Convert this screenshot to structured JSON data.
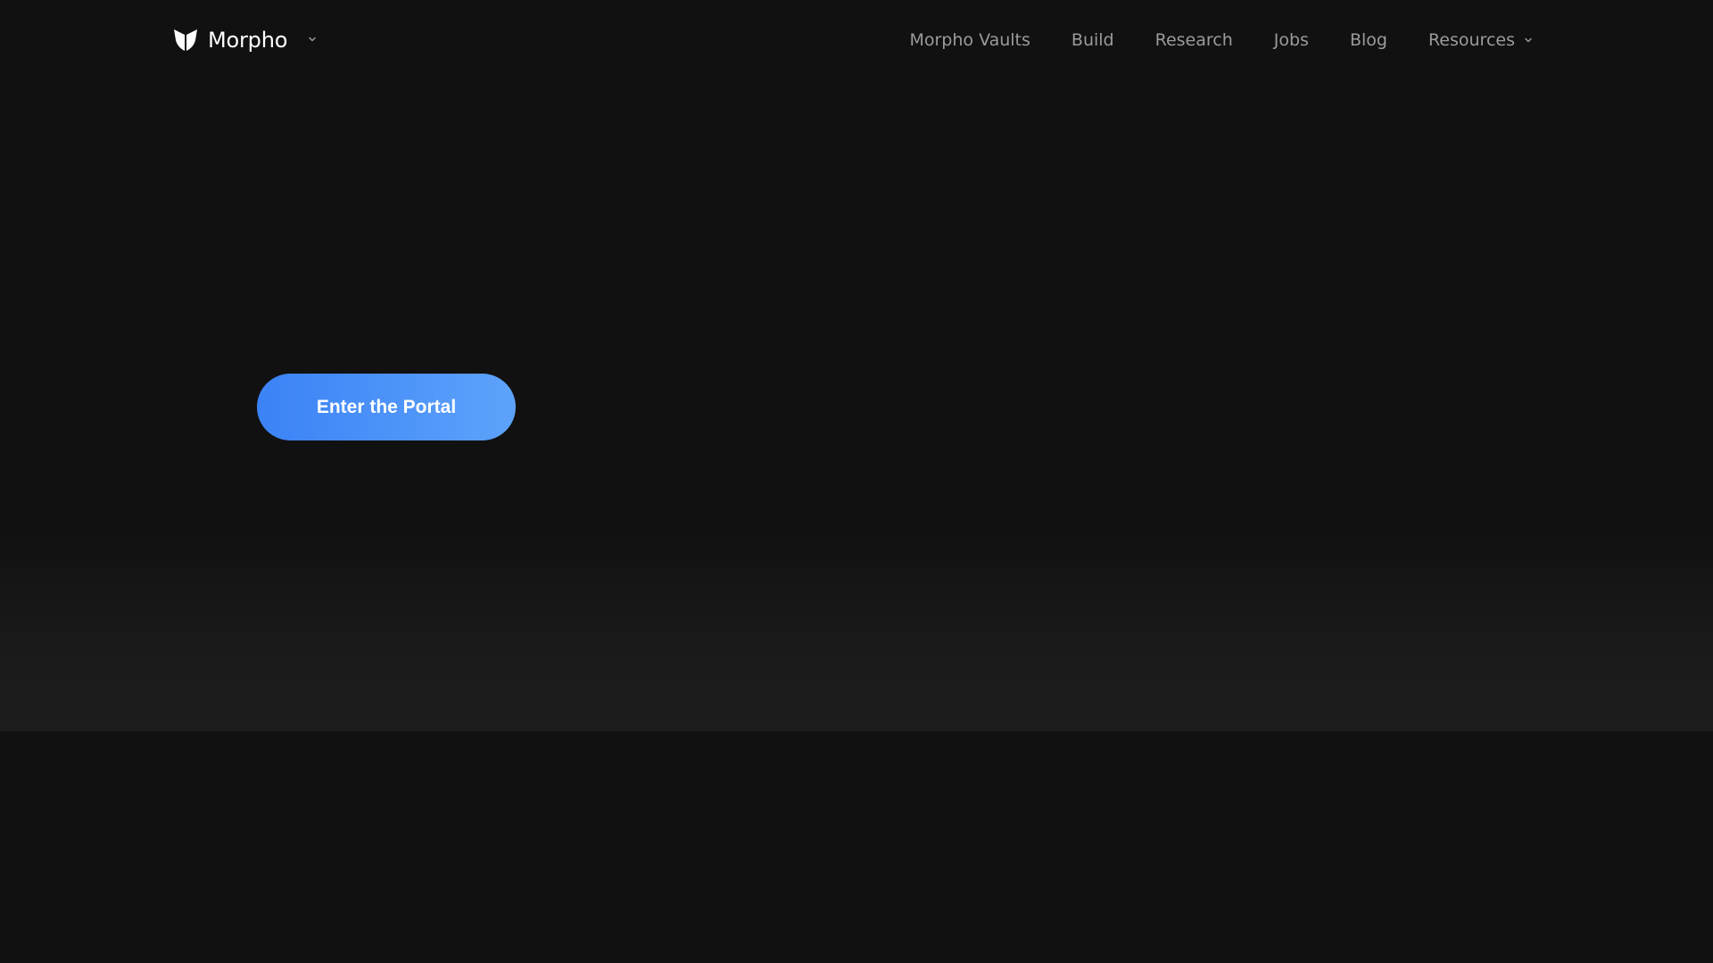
{
  "header": {
    "brand": "Morpho",
    "nav": [
      {
        "label": "Morpho Vaults"
      },
      {
        "label": "Build"
      },
      {
        "label": "Research"
      },
      {
        "label": "Jobs"
      },
      {
        "label": "Blog"
      },
      {
        "label": "Resources"
      }
    ]
  },
  "hero": {
    "cta_label": "Enter the Portal"
  },
  "icons": {
    "logo": "morpho-butterfly-icon",
    "brand_dropdown": "chevron-down-icon",
    "resources_dropdown": "chevron-down-icon"
  },
  "colors": {
    "background": "#111111",
    "nav_text": "#9b9b9b",
    "brand_text": "#ffffff",
    "cta_start": "#3b82f6",
    "cta_end": "#5da3fb"
  }
}
